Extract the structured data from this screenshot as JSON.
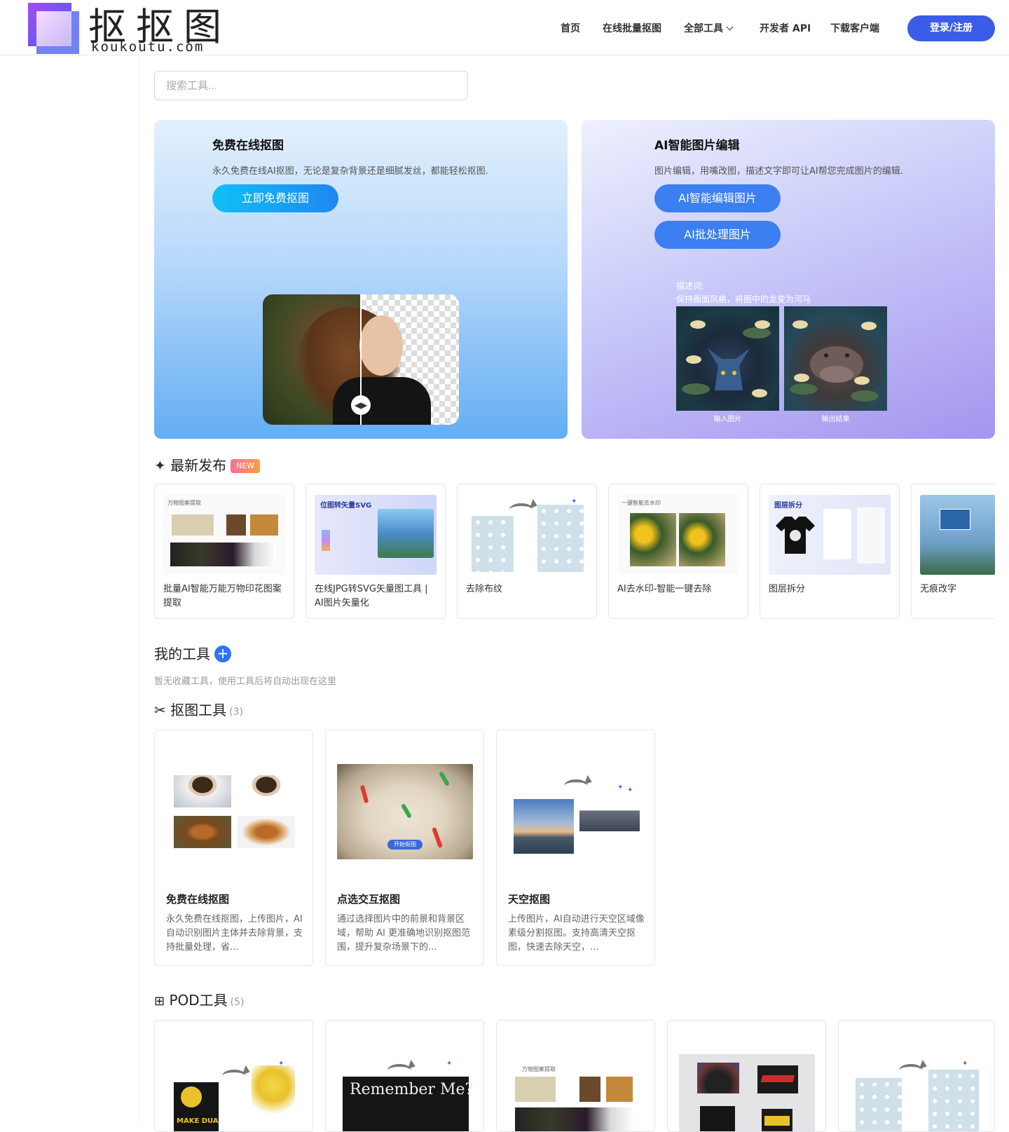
{
  "header": {
    "logo_cn": "抠抠图",
    "logo_en": "koukoutu.com",
    "nav": [
      "首页",
      "在线批量抠图",
      "全部工具",
      "开发者 API",
      "下载客户端"
    ],
    "login": "登录/注册"
  },
  "search": {
    "placeholder": "搜索工具..."
  },
  "hero_left": {
    "title": "免费在线抠图",
    "desc": "永久免费在线AI抠图，无论是复杂背景还是细腻发丝，都能轻松抠图.",
    "button": "立即免费抠图"
  },
  "hero_right": {
    "title": "AI智能图片编辑",
    "desc": "图片编辑，用嘴改图，描述文字即可让AI帮您完成图片的编辑.",
    "button1": "AI智能编辑图片",
    "button2": "AI批处理图片",
    "prompt_label": "描述词:",
    "prompt_text": "保持画面风格，将图中的龙变为河马",
    "cap_in": "输入图片",
    "cap_out": "输出结果"
  },
  "latest": {
    "title": "最新发布",
    "badge": "NEW",
    "items": [
      "批量AI智能万能万物印花图案提取",
      "在线JPG转SVG矢量图工具 | AI图片矢量化",
      "去除布纹",
      "AI去水印-智能一键去除",
      "图层拆分",
      "无痕改字"
    ],
    "thumb_texts": {
      "t1": "万物图案提取",
      "t2": "位图转矢量SVG",
      "t4": "一键智能去水印",
      "t5": "图层拆分"
    }
  },
  "my_tools": {
    "title": "我的工具",
    "plus": "+",
    "empty": "暂无收藏工具，使用工具后将自动出现在这里"
  },
  "cutout": {
    "title": "抠图工具",
    "count": "(3)",
    "cards": [
      {
        "title": "免费在线抠图",
        "desc": "永久免费在线抠图，上传图片，AI自动识别图片主体并去除背景，支持批量处理，省..."
      },
      {
        "title": "点选交互抠图",
        "desc": "通过选择图片中的前景和背景区域，帮助 AI 更准确地识别抠图范围，提升复杂场景下的..."
      },
      {
        "title": "天空抠图",
        "desc": "上传图片，AI自动进行天空区域像素级分割抠图。支持高清天空抠图，快速去除天空，..."
      }
    ],
    "start_label": "开始抠图"
  },
  "pod": {
    "title": "POD工具",
    "count": "(5)",
    "thumb_texts": {
      "remember": "Remember Me?",
      "t3": "万物图案提取",
      "dua": "MAKE DUA"
    }
  },
  "colors": {
    "accent": "#3a5ce9",
    "cyan": "#10c0f6",
    "badge": "#f86e9c"
  }
}
